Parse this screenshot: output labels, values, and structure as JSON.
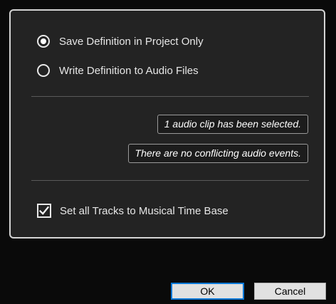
{
  "dialog": {
    "options": {
      "save_project_only": "Save Definition in Project Only",
      "write_audio_files": "Write Definition to Audio Files",
      "selected": "save_project_only"
    },
    "info": {
      "clips_selected": "1 audio clip has been selected.",
      "conflicts": "There are no conflicting audio events."
    },
    "musical_time_base": {
      "label": "Set all Tracks to Musical Time Base",
      "checked": true
    },
    "buttons": {
      "ok": "OK",
      "cancel": "Cancel"
    },
    "colors": {
      "panel_background": "#232323",
      "panel_border": "#d4d4d4",
      "ok_focus_border": "#0a78d7"
    }
  }
}
